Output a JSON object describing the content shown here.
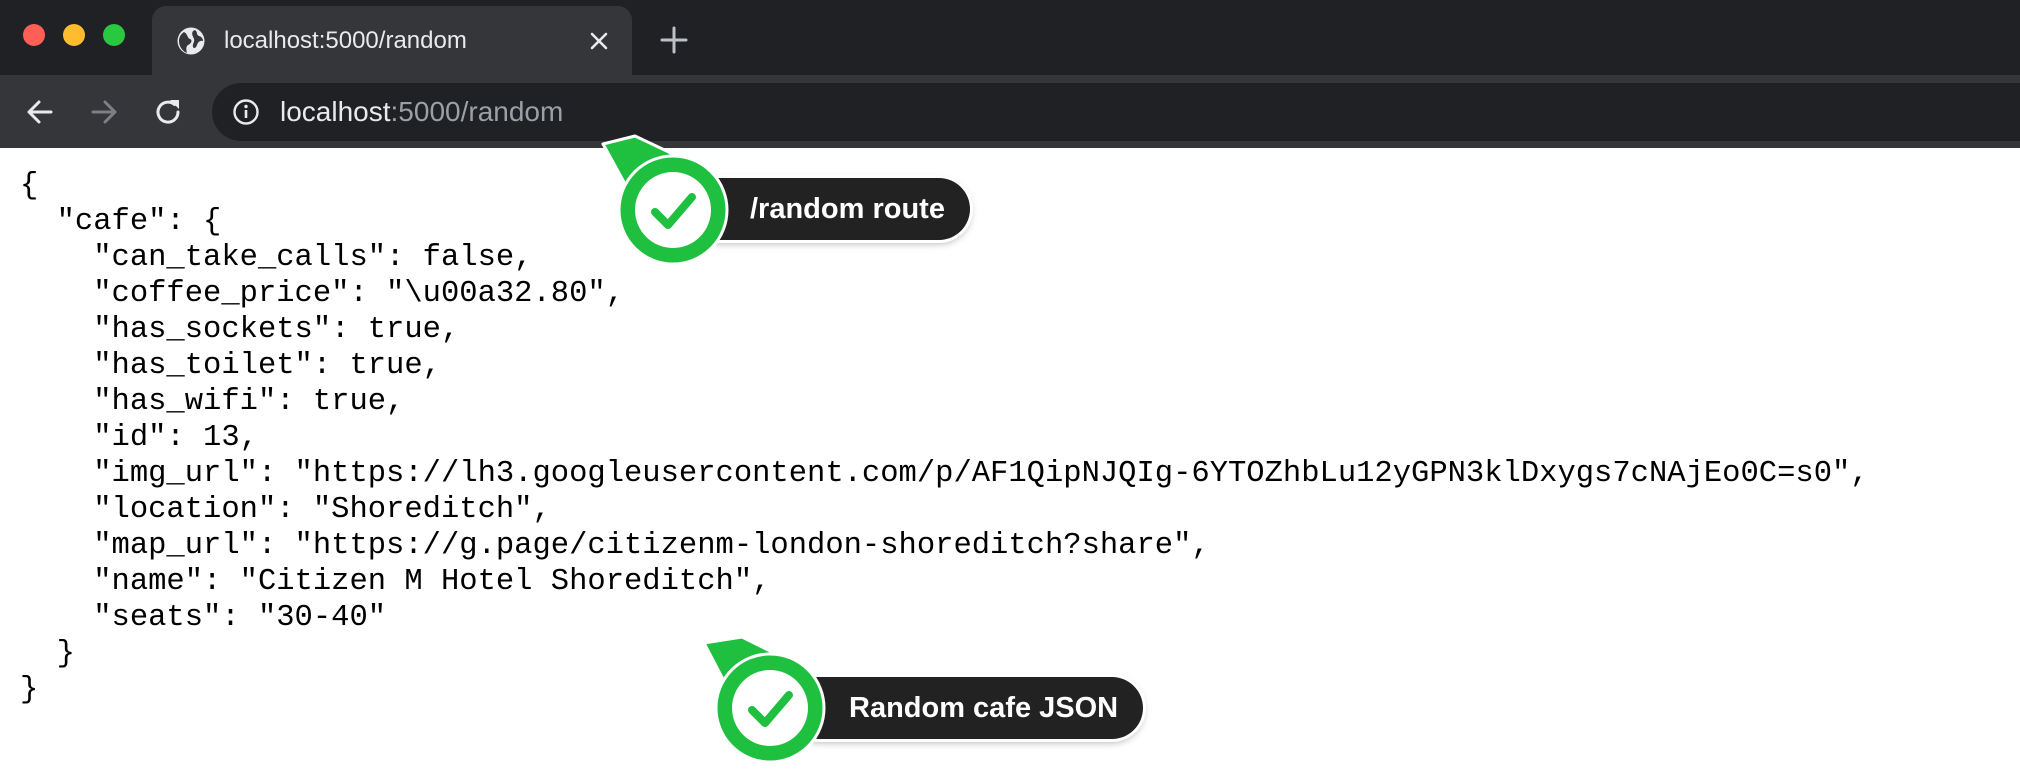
{
  "browser": {
    "tab_title": "localhost:5000/random",
    "url_host": "localhost",
    "url_rest": ":5000/random"
  },
  "icons": {
    "close_traffic": "red-dot",
    "minimize_traffic": "yellow-dot",
    "maximize_traffic": "green-dot",
    "tab_favicon": "globe-icon",
    "tab_close": "close-icon",
    "new_tab": "plus-icon",
    "back": "back-arrow-icon",
    "forward": "forward-arrow-icon",
    "reload": "reload-icon",
    "site_info": "info-icon",
    "callout_marker": "checkmark-icon"
  },
  "json_body": {
    "lines": [
      "{",
      "  \"cafe\": {",
      "    \"can_take_calls\": false,",
      "    \"coffee_price\": \"\\u00a32.80\",",
      "    \"has_sockets\": true,",
      "    \"has_toilet\": true,",
      "    \"has_wifi\": true,",
      "    \"id\": 13,",
      "    \"img_url\": \"https://lh3.googleusercontent.com/p/AF1QipNJQIg-6YTOZhbLu12yGPN3klDxygs7cNAjEo0C=s0\",",
      "    \"location\": \"Shoreditch\",",
      "    \"map_url\": \"https://g.page/citizenm-london-shoreditch?share\",",
      "    \"name\": \"Citizen M Hotel Shoreditch\",",
      "    \"seats\": \"30-40\"",
      "  }",
      "}"
    ]
  },
  "callouts": {
    "route": "/random route",
    "json": "Random cafe JSON"
  },
  "colors": {
    "callout_green": "#1fbf3f",
    "callout_dark": "#222222",
    "titlebar": "#202124",
    "toolbar": "#35363a"
  }
}
